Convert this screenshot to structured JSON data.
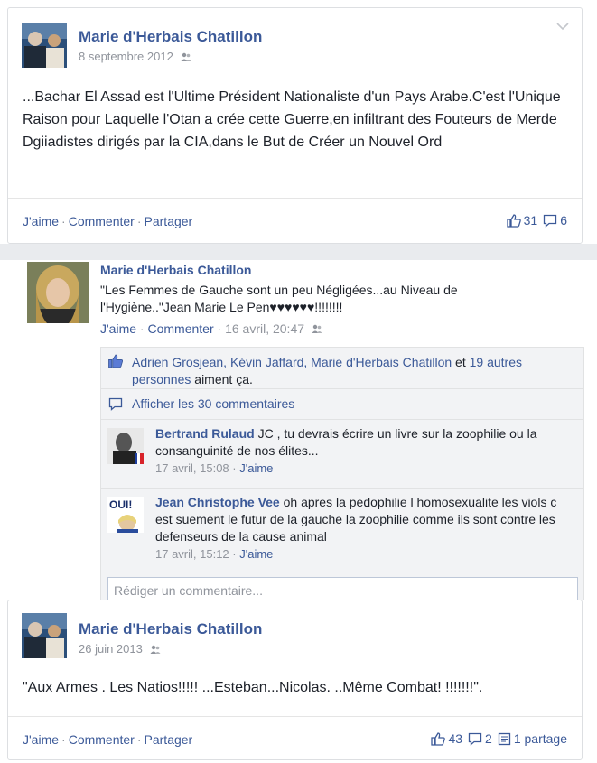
{
  "colors": {
    "link_blue": "#3b5998",
    "meta_gray": "#90949c",
    "text": "#1d2129",
    "ufi_bg": "#f2f3f5"
  },
  "post1": {
    "author": "Marie d'Herbais Chatillon",
    "date": "8 septembre 2012",
    "body": "...Bachar El Assad est l'Ultime Président Nationaliste d'un Pays Arabe.C'est l'Unique Raison pour Laquelle l'Otan a crée cette Guerre,en infiltrant des Fouteurs de Merde Dgiiadistes dirigés par la CIA,dans le But de Créer un Nouvel Ord",
    "actions": {
      "like": "J'aime",
      "comment": "Commenter",
      "share": "Partager",
      "separator": "·"
    },
    "likes_count": "31",
    "comments_count": "6"
  },
  "post2": {
    "author": "Marie d'Herbais Chatillon",
    "text": "\"Les Femmes de Gauche sont un peu Négligées...au Niveau de l'Hygiène..\"Jean Marie Le Pen♥♥♥♥♥♥!!!!!!!!",
    "like_link": "J'aime",
    "comment_link": "Commenter",
    "timestamp": "16 avril, 20:47",
    "likers": {
      "names": "Adrien Grosjean, Kévin Jaffard, Marie d'Herbais Chatillon",
      "and": "et",
      "others": "19 autres personnes",
      "suffix": "aiment ça."
    },
    "show_all": "Afficher les 30 commentaires",
    "comments": [
      {
        "name": "Bertrand Rulaud",
        "text": "JC , tu devrais écrire un livre sur la zoophilie ou la consanguinité de nos élites...",
        "time": "17 avril, 15:08",
        "like": "J'aime"
      },
      {
        "name": "Jean Christophe Vee",
        "text": "oh apres la pedophilie l homosexualite les viols c est suement le futur de la gauche la zoophilie comme ils sont contre les defenseurs de la cause animal",
        "time": "17 avril, 15:12",
        "like": "J'aime",
        "avatar_text": "OUI!"
      }
    ],
    "compose_placeholder": "Rédiger un commentaire..."
  },
  "post3": {
    "author": "Marie d'Herbais Chatillon",
    "date": "26 juin 2013",
    "body": "\"Aux Armes . Les Natios!!!!! ...Esteban...Nicolas. ..Même Combat! !!!!!!!\".",
    "actions": {
      "like": "J'aime",
      "comment": "Commenter",
      "share": "Partager",
      "separator": "·"
    },
    "likes_count": "43",
    "comments_count": "2",
    "shares_label": "1 partage"
  },
  "icons": [
    "audience-friends-icon",
    "thumbs-up-icon",
    "comment-icon",
    "share-icon",
    "chevron-down-icon"
  ]
}
